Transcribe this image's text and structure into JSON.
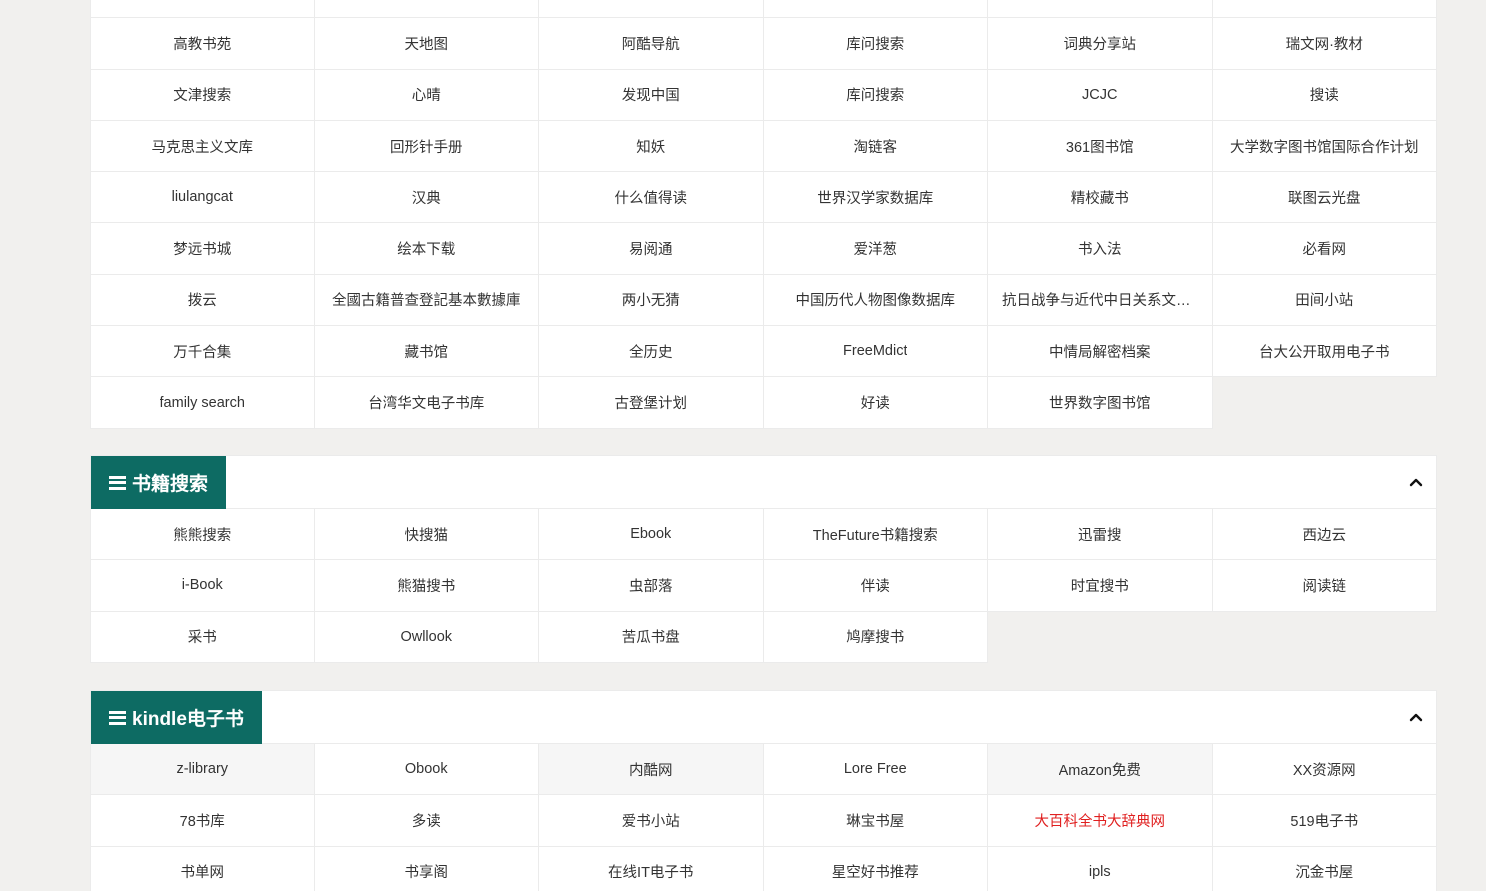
{
  "top_section": {
    "rows": [
      [
        "",
        "",
        "",
        "",
        "",
        ""
      ],
      [
        "高教书苑",
        "天地图",
        "阿酷导航",
        "库问搜索",
        "词典分享站",
        "瑞文网·教材"
      ],
      [
        "文津搜索",
        "心晴",
        "发现中国",
        "库问搜索",
        "JCJC",
        "搜读"
      ],
      [
        "马克思主义文库",
        "回形针手册",
        "知妖",
        "淘链客",
        "361图书馆",
        "大学数字图书馆国际合作计划"
      ],
      [
        "liulangcat",
        "汉典",
        "什么值得读",
        "世界汉学家数据库",
        "精校藏书",
        "联图云光盘"
      ],
      [
        "梦远书城",
        "绘本下载",
        "易阅通",
        "爱洋葱",
        "书入法",
        "必看网"
      ],
      [
        "拨云",
        "全國古籍普查登記基本數據庫",
        "两小无猜",
        "中国历代人物图像数据库",
        "抗日战争与近代中日关系文献数据平台",
        "田间小站"
      ],
      [
        "万千合集",
        "藏书馆",
        "全历史",
        "FreeMdict",
        "中情局解密档案",
        "台大公开取用电子书"
      ],
      [
        "family search",
        "台湾华文电子书库",
        "古登堡计划",
        "好读",
        "世界数字图书馆"
      ]
    ]
  },
  "books_section": {
    "title": "书籍搜索",
    "rows": [
      [
        "熊熊搜索",
        "快搜猫",
        "Ebook",
        "TheFuture书籍搜索",
        "迅雷搜",
        "西边云"
      ],
      [
        "i-Book",
        "熊猫搜书",
        "虫部落",
        "伴读",
        "时宜搜书",
        "阅读链"
      ],
      [
        "采书",
        "Owllook",
        "苦瓜书盘",
        "鸠摩搜书"
      ]
    ]
  },
  "kindle_section": {
    "title": "kindle电子书",
    "rows": [
      [
        "z-library",
        "Obook",
        "内酷网",
        "Lore Free",
        "Amazon免费",
        "XX资源网"
      ],
      [
        "78书库",
        "多读",
        "爱书小站",
        "琳宝书屋",
        "大百科全书大辞典网",
        "519电子书"
      ],
      [
        "书单网",
        "书享阁",
        "在线IT电子书",
        "星空好书推荐",
        "ipls",
        "沉金书屋"
      ]
    ],
    "highlighted_link": "大百科全书大辞典网"
  },
  "icons": {
    "section_tab_icon": "menu-icon",
    "collapse_icon": "chevron-up-icon"
  },
  "colors": {
    "accent": "#0d6b63",
    "highlight_link": "#e02020",
    "background": "#f1f0ee"
  }
}
